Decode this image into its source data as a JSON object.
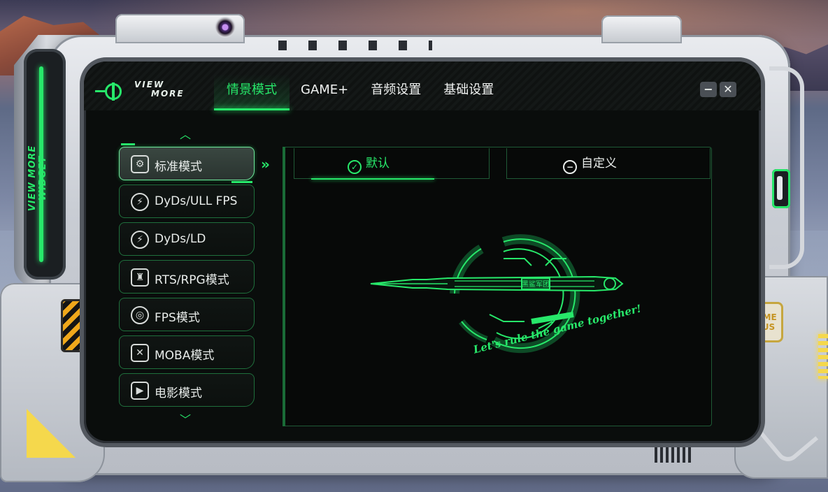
{
  "window": {
    "side_label": "VIEW MORE WIDGET",
    "gameplus_badge": "GAME PLUS",
    "logo": {
      "line1": "VIEW",
      "line2": "MORE"
    },
    "controls": {
      "minimize": "−",
      "close": "✕"
    }
  },
  "nav": {
    "tabs": [
      {
        "label": "情景模式",
        "active": true
      },
      {
        "label": "GAME+",
        "active": false
      },
      {
        "label": "音频设置",
        "active": false
      },
      {
        "label": "基础设置",
        "active": false
      }
    ]
  },
  "modes": [
    {
      "label": "标准模式",
      "icon": "standard-mode-icon",
      "glyph": "⚙",
      "active": true
    },
    {
      "label": "DyDs/ULL FPS",
      "icon": "dyds-ull-icon",
      "glyph": "⚡",
      "active": false
    },
    {
      "label": "DyDs/LD",
      "icon": "dyds-ld-icon",
      "glyph": "⚡",
      "active": false
    },
    {
      "label": "RTS/RPG模式",
      "icon": "rts-rpg-icon",
      "glyph": "♜",
      "active": false
    },
    {
      "label": "FPS模式",
      "icon": "fps-target-icon",
      "glyph": "◎",
      "active": false
    },
    {
      "label": "MOBA模式",
      "icon": "moba-swords-icon",
      "glyph": "✕",
      "active": false
    },
    {
      "label": "电影模式",
      "icon": "movie-icon",
      "glyph": "▶",
      "active": false
    }
  ],
  "subtabs": {
    "default": {
      "label": "默认",
      "active": true
    },
    "custom": {
      "label": "自定义",
      "active": false
    }
  },
  "artwork": {
    "slogan": "Let's rule the game together!",
    "emblem_text": "黑鲨军团"
  },
  "colors": {
    "accent": "#27e86a",
    "screen_bg": "#0a0d0c",
    "hazard": "#f0a81b",
    "highlight_yellow": "#f5d84c"
  }
}
